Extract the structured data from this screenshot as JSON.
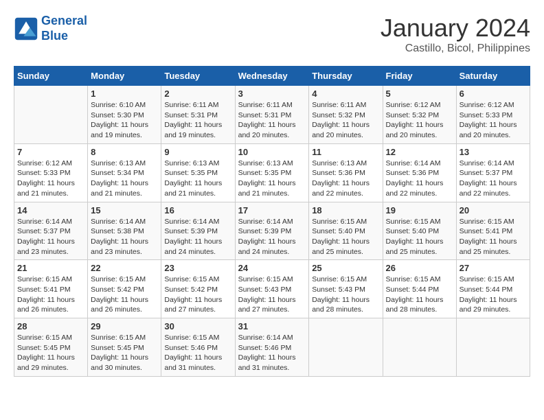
{
  "logo": {
    "line1": "General",
    "line2": "Blue"
  },
  "title": "January 2024",
  "subtitle": "Castillo, Bicol, Philippines",
  "days_header": [
    "Sunday",
    "Monday",
    "Tuesday",
    "Wednesday",
    "Thursday",
    "Friday",
    "Saturday"
  ],
  "weeks": [
    [
      {
        "day": "",
        "sunrise": "",
        "sunset": "",
        "daylight": ""
      },
      {
        "day": "1",
        "sunrise": "Sunrise: 6:10 AM",
        "sunset": "Sunset: 5:30 PM",
        "daylight": "Daylight: 11 hours and 19 minutes."
      },
      {
        "day": "2",
        "sunrise": "Sunrise: 6:11 AM",
        "sunset": "Sunset: 5:31 PM",
        "daylight": "Daylight: 11 hours and 19 minutes."
      },
      {
        "day": "3",
        "sunrise": "Sunrise: 6:11 AM",
        "sunset": "Sunset: 5:31 PM",
        "daylight": "Daylight: 11 hours and 20 minutes."
      },
      {
        "day": "4",
        "sunrise": "Sunrise: 6:11 AM",
        "sunset": "Sunset: 5:32 PM",
        "daylight": "Daylight: 11 hours and 20 minutes."
      },
      {
        "day": "5",
        "sunrise": "Sunrise: 6:12 AM",
        "sunset": "Sunset: 5:32 PM",
        "daylight": "Daylight: 11 hours and 20 minutes."
      },
      {
        "day": "6",
        "sunrise": "Sunrise: 6:12 AM",
        "sunset": "Sunset: 5:33 PM",
        "daylight": "Daylight: 11 hours and 20 minutes."
      }
    ],
    [
      {
        "day": "7",
        "sunrise": "Sunrise: 6:12 AM",
        "sunset": "Sunset: 5:33 PM",
        "daylight": "Daylight: 11 hours and 21 minutes."
      },
      {
        "day": "8",
        "sunrise": "Sunrise: 6:13 AM",
        "sunset": "Sunset: 5:34 PM",
        "daylight": "Daylight: 11 hours and 21 minutes."
      },
      {
        "day": "9",
        "sunrise": "Sunrise: 6:13 AM",
        "sunset": "Sunset: 5:35 PM",
        "daylight": "Daylight: 11 hours and 21 minutes."
      },
      {
        "day": "10",
        "sunrise": "Sunrise: 6:13 AM",
        "sunset": "Sunset: 5:35 PM",
        "daylight": "Daylight: 11 hours and 21 minutes."
      },
      {
        "day": "11",
        "sunrise": "Sunrise: 6:13 AM",
        "sunset": "Sunset: 5:36 PM",
        "daylight": "Daylight: 11 hours and 22 minutes."
      },
      {
        "day": "12",
        "sunrise": "Sunrise: 6:14 AM",
        "sunset": "Sunset: 5:36 PM",
        "daylight": "Daylight: 11 hours and 22 minutes."
      },
      {
        "day": "13",
        "sunrise": "Sunrise: 6:14 AM",
        "sunset": "Sunset: 5:37 PM",
        "daylight": "Daylight: 11 hours and 22 minutes."
      }
    ],
    [
      {
        "day": "14",
        "sunrise": "Sunrise: 6:14 AM",
        "sunset": "Sunset: 5:37 PM",
        "daylight": "Daylight: 11 hours and 23 minutes."
      },
      {
        "day": "15",
        "sunrise": "Sunrise: 6:14 AM",
        "sunset": "Sunset: 5:38 PM",
        "daylight": "Daylight: 11 hours and 23 minutes."
      },
      {
        "day": "16",
        "sunrise": "Sunrise: 6:14 AM",
        "sunset": "Sunset: 5:39 PM",
        "daylight": "Daylight: 11 hours and 24 minutes."
      },
      {
        "day": "17",
        "sunrise": "Sunrise: 6:14 AM",
        "sunset": "Sunset: 5:39 PM",
        "daylight": "Daylight: 11 hours and 24 minutes."
      },
      {
        "day": "18",
        "sunrise": "Sunrise: 6:15 AM",
        "sunset": "Sunset: 5:40 PM",
        "daylight": "Daylight: 11 hours and 25 minutes."
      },
      {
        "day": "19",
        "sunrise": "Sunrise: 6:15 AM",
        "sunset": "Sunset: 5:40 PM",
        "daylight": "Daylight: 11 hours and 25 minutes."
      },
      {
        "day": "20",
        "sunrise": "Sunrise: 6:15 AM",
        "sunset": "Sunset: 5:41 PM",
        "daylight": "Daylight: 11 hours and 25 minutes."
      }
    ],
    [
      {
        "day": "21",
        "sunrise": "Sunrise: 6:15 AM",
        "sunset": "Sunset: 5:41 PM",
        "daylight": "Daylight: 11 hours and 26 minutes."
      },
      {
        "day": "22",
        "sunrise": "Sunrise: 6:15 AM",
        "sunset": "Sunset: 5:42 PM",
        "daylight": "Daylight: 11 hours and 26 minutes."
      },
      {
        "day": "23",
        "sunrise": "Sunrise: 6:15 AM",
        "sunset": "Sunset: 5:42 PM",
        "daylight": "Daylight: 11 hours and 27 minutes."
      },
      {
        "day": "24",
        "sunrise": "Sunrise: 6:15 AM",
        "sunset": "Sunset: 5:43 PM",
        "daylight": "Daylight: 11 hours and 27 minutes."
      },
      {
        "day": "25",
        "sunrise": "Sunrise: 6:15 AM",
        "sunset": "Sunset: 5:43 PM",
        "daylight": "Daylight: 11 hours and 28 minutes."
      },
      {
        "day": "26",
        "sunrise": "Sunrise: 6:15 AM",
        "sunset": "Sunset: 5:44 PM",
        "daylight": "Daylight: 11 hours and 28 minutes."
      },
      {
        "day": "27",
        "sunrise": "Sunrise: 6:15 AM",
        "sunset": "Sunset: 5:44 PM",
        "daylight": "Daylight: 11 hours and 29 minutes."
      }
    ],
    [
      {
        "day": "28",
        "sunrise": "Sunrise: 6:15 AM",
        "sunset": "Sunset: 5:45 PM",
        "daylight": "Daylight: 11 hours and 29 minutes."
      },
      {
        "day": "29",
        "sunrise": "Sunrise: 6:15 AM",
        "sunset": "Sunset: 5:45 PM",
        "daylight": "Daylight: 11 hours and 30 minutes."
      },
      {
        "day": "30",
        "sunrise": "Sunrise: 6:15 AM",
        "sunset": "Sunset: 5:46 PM",
        "daylight": "Daylight: 11 hours and 31 minutes."
      },
      {
        "day": "31",
        "sunrise": "Sunrise: 6:14 AM",
        "sunset": "Sunset: 5:46 PM",
        "daylight": "Daylight: 11 hours and 31 minutes."
      },
      {
        "day": "",
        "sunrise": "",
        "sunset": "",
        "daylight": ""
      },
      {
        "day": "",
        "sunrise": "",
        "sunset": "",
        "daylight": ""
      },
      {
        "day": "",
        "sunrise": "",
        "sunset": "",
        "daylight": ""
      }
    ]
  ]
}
